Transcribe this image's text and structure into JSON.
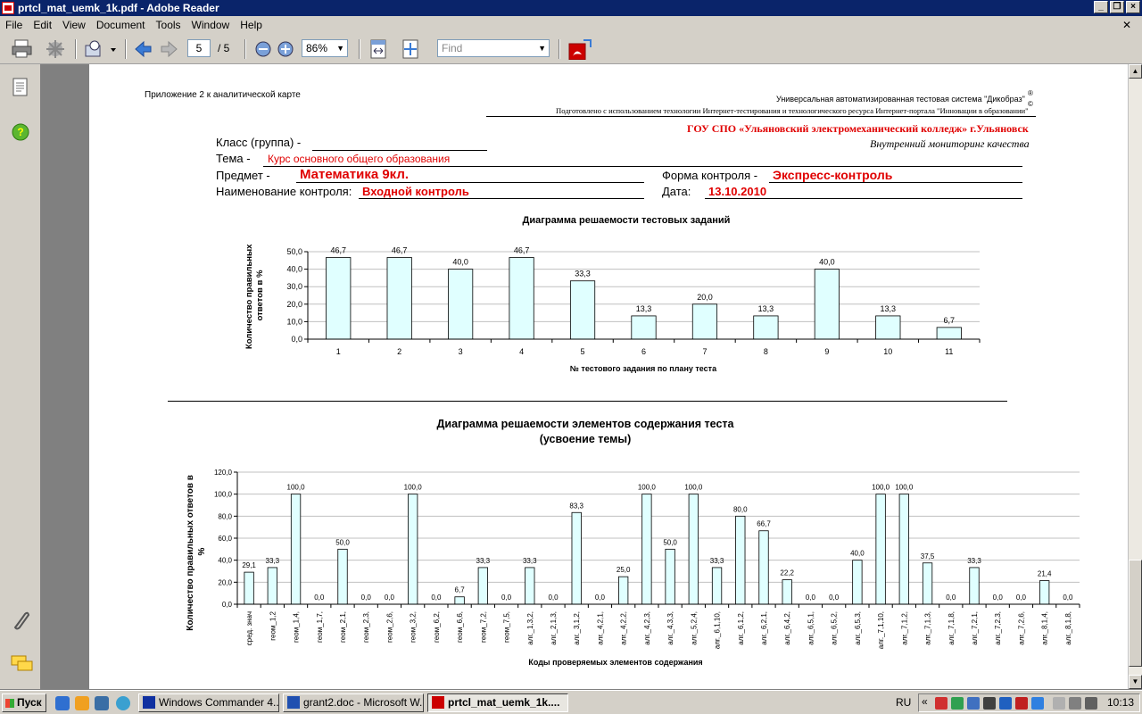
{
  "window": {
    "title": "prtcl_mat_uemk_1k.pdf - Adobe Reader"
  },
  "menu": {
    "items": [
      "File",
      "Edit",
      "View",
      "Document",
      "Tools",
      "Window",
      "Help"
    ]
  },
  "toolbar": {
    "page_current": "5",
    "page_total": "/ 5",
    "zoom": "86%",
    "find_placeholder": "Find"
  },
  "doc": {
    "appendix": "Приложение 2 к аналитической карте",
    "system_line": "Универсальная автоматизированная тестовая система \"Дикобраз\"",
    "reg_mark": "®",
    "prepared_line": "Подготовлено с использованием технологии Интернет-тестирования и технологического ресурса  Интернет-портала \"Инновации в образовании\"",
    "copy_mark": "©",
    "college": "ГОУ СПО «Ульяновский электромеханический колледж» г.Ульяновск",
    "monitoring": "Внутренний мониторинг  качества",
    "class_label": "Класс (группа) -",
    "theme_label": "Тема -",
    "theme_value": "Курс основного общего образования",
    "subject_label": "Предмет  -",
    "subject_value": "Математика 9кл.",
    "form_label": "Форма контроля -",
    "form_value": "Экспресс-контроль",
    "control_label": "Наименование контроля:",
    "control_value": "Входной контроль",
    "date_label": "Дата:",
    "date_value": "13.10.2010"
  },
  "chart_data": [
    {
      "type": "bar",
      "title": "Диаграмма решаемости тестовых заданий",
      "xlabel": "№ тестового задания по плану теста",
      "ylabel": "Количество правильных ответов в %",
      "categories": [
        "1",
        "2",
        "3",
        "4",
        "5",
        "6",
        "7",
        "8",
        "9",
        "10",
        "11"
      ],
      "values": [
        46.7,
        46.7,
        40.0,
        46.7,
        33.3,
        13.3,
        20.0,
        13.3,
        40.0,
        13.3,
        6.7
      ],
      "data_labels": [
        "46,7",
        "46,7",
        "40,0",
        "46,7",
        "33,3",
        "13,3",
        "20,0",
        "13,3",
        "40,0",
        "13,3",
        "6,7"
      ],
      "yticks": [
        "0,0",
        "10,0",
        "20,0",
        "30,0",
        "40,0",
        "50,0"
      ],
      "ylim": [
        0,
        50
      ],
      "grid": true,
      "bar_color": "#e0ffff"
    },
    {
      "type": "bar",
      "title": "Диаграмма решаемости элементов содержания теста",
      "subtitle": "(усвоение темы)",
      "xlabel": "Коды проверяемых элементов содержания",
      "ylabel": "Количество правильных ответов в %",
      "categories": [
        "сред. знач",
        "геом_1,2",
        "геом_1,4,",
        "геом_1,7,",
        "геом_2,1,",
        "геом_2,3,",
        "геом_2,6,",
        "геом_3,2,",
        "геом_6,2,",
        "геом_6,6,",
        "геом_7,2,",
        "геом_7,5,",
        "алг._1,3,2,",
        "алг._2,1,3,",
        "алг._3,1,2,",
        "алг._4,2,1,",
        "алг._4,2,2,",
        "алг._4,2,3,",
        "алг._4,3,3,",
        "алг._5,2,4,",
        "алг._6,1,10,",
        "алг._6,1,2,",
        "алг._6,2,1,",
        "алг._6,4,2,",
        "алг._6,5,1,",
        "алг._6,5,2,",
        "алг._6,5,3,",
        "алг._7,1,10,",
        "алг._7,1,2,",
        "алг._7,1,3,",
        "алг._7,1,8,",
        "алг._7,2,1,",
        "алг._7,2,3,",
        "алг._7,2,6,",
        "алг._8,1,4,",
        "алг._8,1,8,"
      ],
      "values": [
        29.1,
        33.3,
        100.0,
        0.0,
        50.0,
        0.0,
        0.0,
        100.0,
        0.0,
        6.7,
        33.3,
        0.0,
        33.3,
        0.0,
        83.3,
        0.0,
        25.0,
        100.0,
        50.0,
        100.0,
        33.3,
        80.0,
        66.7,
        22.2,
        0.0,
        0.0,
        40.0,
        100.0,
        100.0,
        37.5,
        0.0,
        33.3,
        0.0,
        0.0,
        21.4,
        0.0
      ],
      "data_labels": [
        "29,1",
        "33,3",
        "100,0",
        "0,0",
        "50,0",
        "0,0",
        "0,0",
        "100,0",
        "0,0",
        "6,7",
        "33,3",
        "0,0",
        "33,3",
        "0,0",
        "83,3",
        "0,0",
        "25,0",
        "100,0",
        "50,0",
        "100,0",
        "33,3",
        "80,0",
        "66,7",
        "22,2",
        "0,0",
        "0,0",
        "40,0",
        "100,0",
        "100,0",
        "37,5",
        "0,0",
        "33,3",
        "0,0",
        "0,0",
        "21,4",
        "0,0"
      ],
      "yticks": [
        "0,0",
        "20,0",
        "40,0",
        "60,0",
        "80,0",
        "100,0",
        "120,0"
      ],
      "ylim": [
        0,
        120
      ],
      "grid": true,
      "bar_color": "#e0ffff"
    }
  ],
  "taskbar": {
    "start": "Пуск",
    "tasks": [
      "Windows Commander 4....",
      "grant2.doc - Microsoft W...",
      "prtcl_mat_uemk_1k...."
    ],
    "lang": "RU",
    "time": "10:13"
  }
}
